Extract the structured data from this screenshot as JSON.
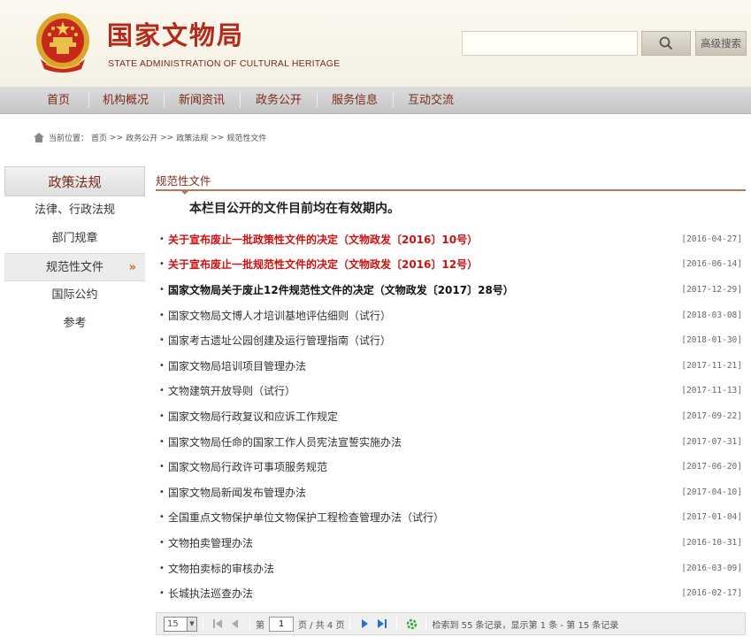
{
  "header": {
    "title": "国家文物局",
    "subtitle": "STATE ADMINISTRATION OF CULTURAL HERITAGE",
    "search_placeholder": "",
    "advanced_search": "高级搜索"
  },
  "nav": {
    "items": [
      "首页",
      "机构概况",
      "新闻资讯",
      "政务公开",
      "服务信息",
      "互动交流"
    ]
  },
  "breadcrumb": {
    "label": "当前位置：",
    "items": [
      "首页",
      "政务公开",
      "政策法规",
      "规范性文件"
    ],
    "separator": ">>"
  },
  "sidebar": {
    "title": "政策法规",
    "items": [
      {
        "label": "法律、行政法规"
      },
      {
        "label": "部门规章"
      },
      {
        "label": "规范性文件",
        "active": true
      },
      {
        "label": "国际公约"
      },
      {
        "label": "参考"
      }
    ],
    "active_marker": "»"
  },
  "main": {
    "section_title": "规范性文件",
    "notice": "本栏目公开的文件目前均在有效期内。",
    "documents": [
      {
        "title": "关于宣布废止一批政策性文件的决定（文物政发〔2016〕10号）",
        "date": "[2016-04-27]",
        "style": "red"
      },
      {
        "title": "关于宣布废止一批规范性文件的决定（文物政发〔2016〕12号）",
        "date": "[2016-06-14]",
        "style": "red"
      },
      {
        "title": "国家文物局关于废止12件规范性文件的决定（文物政发〔2017〕28号）",
        "date": "[2017-12-29]",
        "style": "bold"
      },
      {
        "title": "国家文物局文博人才培训基地评估细则（试行）",
        "date": "[2018-03-08]",
        "style": "normal"
      },
      {
        "title": "国家考古遗址公园创建及运行管理指南（试行）",
        "date": "[2018-01-30]",
        "style": "normal"
      },
      {
        "title": "国家文物局培训项目管理办法",
        "date": "[2017-11-21]",
        "style": "normal"
      },
      {
        "title": "文物建筑开放导则（试行）",
        "date": "[2017-11-13]",
        "style": "normal"
      },
      {
        "title": "国家文物局行政复议和应诉工作规定",
        "date": "[2017-09-22]",
        "style": "normal"
      },
      {
        "title": "国家文物局任命的国家工作人员宪法宣誓实施办法",
        "date": "[2017-07-31]",
        "style": "normal"
      },
      {
        "title": "国家文物局行政许可事项服务规范",
        "date": "[2017-06-20]",
        "style": "normal"
      },
      {
        "title": "国家文物局新闻发布管理办法",
        "date": "[2017-04-10]",
        "style": "normal"
      },
      {
        "title": "全国重点文物保护单位文物保护工程检查管理办法（试行）",
        "date": "[2017-01-04]",
        "style": "normal"
      },
      {
        "title": "文物拍卖管理办法",
        "date": "[2016-10-31]",
        "style": "normal"
      },
      {
        "title": "文物拍卖标的审核办法",
        "date": "[2016-03-09]",
        "style": "normal"
      },
      {
        "title": "长城执法巡查办法",
        "date": "[2016-02-17]",
        "style": "normal"
      }
    ]
  },
  "pager": {
    "page_size": "15",
    "page_label_prefix": "第",
    "current_page": "1",
    "page_label_suffix": "页 / 共 4 页",
    "summary": "检索到 55 条记录，显示第 1 条 - 第 15 条记录"
  },
  "colors": {
    "brand_red": "#b52a18",
    "nav_text": "#7a2a1a",
    "highlight_red": "#cc1111",
    "active_arrow": "#e0651a"
  }
}
